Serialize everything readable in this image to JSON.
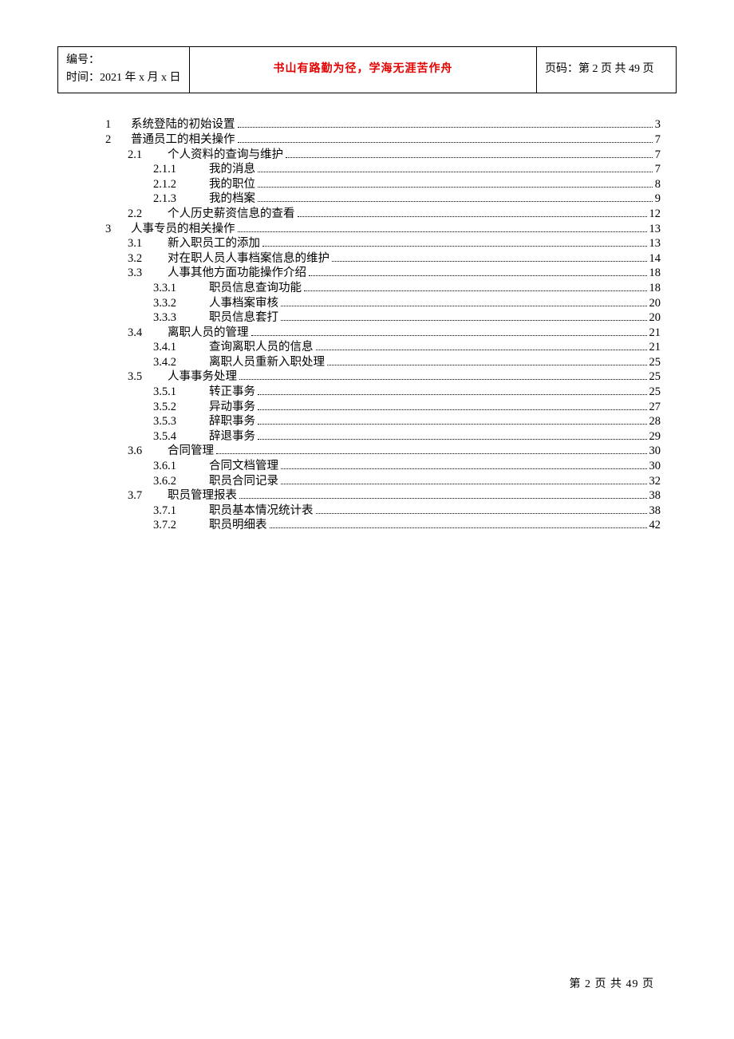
{
  "header": {
    "serial_label": "编号：",
    "date_label": "时间：",
    "date_value": "2021 年 x 月 x 日",
    "motto": "书山有路勤为径，学海无涯苦作舟",
    "page_label": "页码：",
    "page_value": "第 2 页  共 49 页"
  },
  "toc": [
    {
      "level": 1,
      "num": "1",
      "title": "系统登陆的初始设置",
      "page": "3"
    },
    {
      "level": 1,
      "num": "2",
      "title": "普通员工的相关操作",
      "page": "7"
    },
    {
      "level": 2,
      "num": "2.1",
      "title": "个人资料的查询与维护",
      "page": "7"
    },
    {
      "level": 3,
      "num": "2.1.1",
      "title": "我的消息",
      "page": "7"
    },
    {
      "level": 3,
      "num": "2.1.2",
      "title": "我的职位",
      "page": "8"
    },
    {
      "level": 3,
      "num": "2.1.3",
      "title": "我的档案",
      "page": "9"
    },
    {
      "level": 2,
      "num": "2.2",
      "title": "个人历史薪资信息的查看",
      "page": "12"
    },
    {
      "level": 1,
      "num": "3",
      "title": "人事专员的相关操作",
      "page": "13"
    },
    {
      "level": 2,
      "num": "3.1",
      "title": "新入职员工的添加",
      "page": "13"
    },
    {
      "level": 2,
      "num": "3.2",
      "title": "对在职人员人事档案信息的维护",
      "page": "14"
    },
    {
      "level": 2,
      "num": "3.3",
      "title": "人事其他方面功能操作介绍",
      "page": "18"
    },
    {
      "level": 3,
      "num": "3.3.1",
      "title": "职员信息查询功能",
      "page": "18"
    },
    {
      "level": 3,
      "num": "3.3.2",
      "title": "人事档案审核",
      "page": "20"
    },
    {
      "level": 3,
      "num": "3.3.3",
      "title": "职员信息套打",
      "page": "20"
    },
    {
      "level": 2,
      "num": "3.4",
      "title": "离职人员的管理",
      "page": "21"
    },
    {
      "level": 3,
      "num": "3.4.1",
      "title": "查询离职人员的信息",
      "page": "21"
    },
    {
      "level": 3,
      "num": "3.4.2",
      "title": "离职人员重新入职处理",
      "page": "25"
    },
    {
      "level": 2,
      "num": "3.5",
      "title": "人事事务处理",
      "page": "25"
    },
    {
      "level": 3,
      "num": "3.5.1",
      "title": "转正事务",
      "page": "25"
    },
    {
      "level": 3,
      "num": "3.5.2",
      "title": "异动事务",
      "page": "27"
    },
    {
      "level": 3,
      "num": "3.5.3",
      "title": "辞职事务",
      "page": "28"
    },
    {
      "level": 3,
      "num": "3.5.4",
      "title": "辞退事务",
      "page": "29"
    },
    {
      "level": 2,
      "num": "3.6",
      "title": "合同管理",
      "page": "30"
    },
    {
      "level": 3,
      "num": "3.6.1",
      "title": "合同文档管理",
      "page": "30"
    },
    {
      "level": 3,
      "num": "3.6.2",
      "title": "职员合同记录",
      "page": "32"
    },
    {
      "level": 2,
      "num": "3.7",
      "title": "职员管理报表",
      "page": "38"
    },
    {
      "level": 3,
      "num": "3.7.1",
      "title": "职员基本情况统计表",
      "page": "38"
    },
    {
      "level": 3,
      "num": "3.7.2",
      "title": "职员明细表",
      "page": "42"
    }
  ],
  "footer": {
    "text": "第 2 页 共 49 页"
  }
}
